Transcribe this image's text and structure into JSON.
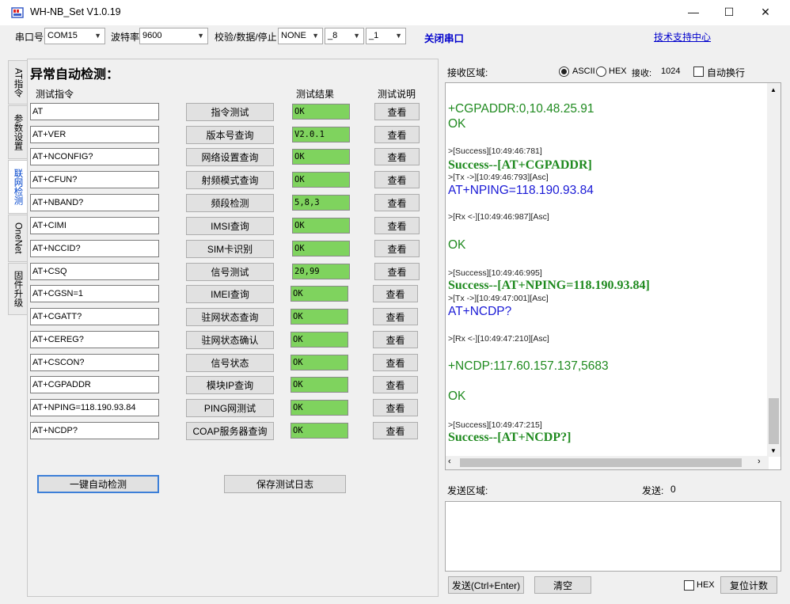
{
  "window": {
    "title": "WH-NB_Set V1.0.19",
    "minimize": "—",
    "maximize": "☐",
    "close": "✕"
  },
  "toolbar": {
    "port_label": "串口号",
    "port_value": "COM15",
    "baud_label": "波特率",
    "baud_value": "9600",
    "parity_label": "校验/数据/停止",
    "parity_value": "NONE",
    "data_value": "_8",
    "stop_value": "_1",
    "close_port": "关闭串口",
    "support_link": "技术支持中心"
  },
  "side_tabs": [
    "AT指令",
    "参数设置",
    "联网检测",
    "OneNet",
    "固件升级"
  ],
  "auto_test": {
    "heading": "异常自动检测：",
    "col_cmd": "测试指令",
    "col_result": "测试结果",
    "col_desc": "测试说明",
    "view_label": "查看",
    "rows": [
      {
        "cmd": "AT",
        "action": "指令测试",
        "result": "OK"
      },
      {
        "cmd": "AT+VER",
        "action": "版本号查询",
        "result": "V2.0.1"
      },
      {
        "cmd": "AT+NCONFIG?",
        "action": "网络设置查询",
        "result": "OK"
      },
      {
        "cmd": "AT+CFUN?",
        "action": "射频模式查询",
        "result": "OK"
      },
      {
        "cmd": "AT+NBAND?",
        "action": "频段检测",
        "result": "5,8,3"
      },
      {
        "cmd": "AT+CIMI",
        "action": "IMSI查询",
        "result": "OK"
      },
      {
        "cmd": "AT+NCCID?",
        "action": "SIM卡识别",
        "result": "OK"
      },
      {
        "cmd": "AT+CSQ",
        "action": "信号测试",
        "result": "20,99"
      },
      {
        "cmd": "AT+CGSN=1",
        "action": "IMEI查询",
        "result": "OK"
      },
      {
        "cmd": "AT+CGATT?",
        "action": "驻网状态查询",
        "result": "OK"
      },
      {
        "cmd": "AT+CEREG?",
        "action": "驻网状态确认",
        "result": "OK"
      },
      {
        "cmd": "AT+CSCON?",
        "action": "信号状态",
        "result": "OK"
      },
      {
        "cmd": "AT+CGPADDR",
        "action": "模块IP查询",
        "result": "OK"
      },
      {
        "cmd": "AT+NPING=118.190.93.84",
        "action": "PING网测试",
        "result": "OK"
      },
      {
        "cmd": "AT+NCDP?",
        "action": "COAP服务器查询",
        "result": "OK"
      }
    ],
    "one_click": "一键自动检测",
    "save_log": "保存测试日志"
  },
  "receive": {
    "label": "接收区域:",
    "ascii": "ASCII",
    "hex": "HEX",
    "count_label": "接收:",
    "count": "1024",
    "autowrap": "自动换行",
    "lines": [
      {
        "cls": "green",
        "text": "+CGPADDR:0,10.48.25.91"
      },
      {
        "cls": "green",
        "text": "OK"
      },
      {
        "cls": "meta",
        "text": ">[Success][10:49:46:781]"
      },
      {
        "cls": "succ",
        "text": "Success--[AT+CGPADDR]"
      },
      {
        "cls": "meta",
        "text": ">[Tx ->][10:49:46:793][Asc]"
      },
      {
        "cls": "blue",
        "text": "AT+NPING=118.190.93.84"
      },
      {
        "cls": "meta",
        "text": ">[Rx <-][10:49:46:987][Asc]"
      },
      {
        "cls": "green",
        "text": "OK"
      },
      {
        "cls": "meta",
        "text": ">[Success][10:49:46:995]"
      },
      {
        "cls": "succ",
        "text": "Success--[AT+NPING=118.190.93.84]"
      },
      {
        "cls": "meta",
        "text": ">[Tx ->][10:49:47:001][Asc]"
      },
      {
        "cls": "blue",
        "text": "AT+NCDP?"
      },
      {
        "cls": "meta",
        "text": ">[Rx <-][10:49:47:210][Asc]"
      },
      {
        "cls": "green",
        "text": "+NCDP:117.60.157.137,5683"
      },
      {
        "cls": "green",
        "text": "OK"
      },
      {
        "cls": "meta",
        "text": ">[Success][10:49:47:215]"
      },
      {
        "cls": "succ",
        "text": "Success--[AT+NCDP?]"
      }
    ]
  },
  "send": {
    "label": "发送区域:",
    "count_label": "发送:",
    "count": "0",
    "send_btn": "发送(Ctrl+Enter)",
    "clear_btn": "清空",
    "hex": "HEX",
    "reset_btn": "复位计数"
  },
  "colors": {
    "result_bg": "#7fd35e",
    "success": "#1f8a1f",
    "tx": "#1a1ad6",
    "link": "#0000cc"
  }
}
